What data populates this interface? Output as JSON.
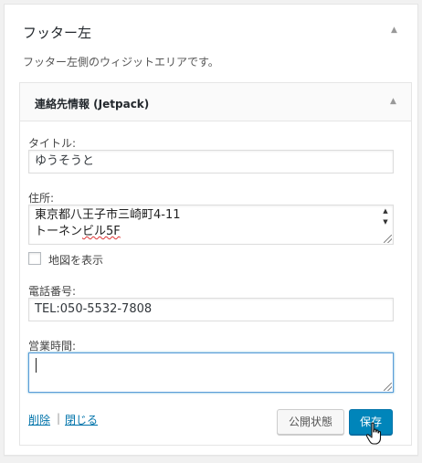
{
  "sidebar": {
    "title": "フッター左",
    "description": "フッター左側のウィジットエリアです。",
    "toggle_icon": "triangle-up-icon"
  },
  "widget": {
    "title": "連絡先情報 (Jetpack)",
    "toggle_icon": "triangle-up-icon",
    "fields": {
      "title_label": "タイトル:",
      "title_value": "ゆうそうと",
      "address_label": "住所:",
      "address_line1": "東京都八王子市三崎町4-11",
      "address_line2_a": "トーネン",
      "address_line2_b": "ビル5F",
      "show_map_label": "地図を表示",
      "show_map_checked": false,
      "phone_label": "電話番号:",
      "phone_value": "TEL:050-5532-7808",
      "hours_label": "営業時間:",
      "hours_value": ""
    },
    "actions": {
      "delete_label": "削除",
      "separator": "|",
      "close_label": "閉じる",
      "visibility_label": "公開状態",
      "save_label": "保存"
    }
  },
  "colors": {
    "primary": "#0085ba",
    "link": "#0073aa",
    "focus": "#5b9dd9"
  }
}
